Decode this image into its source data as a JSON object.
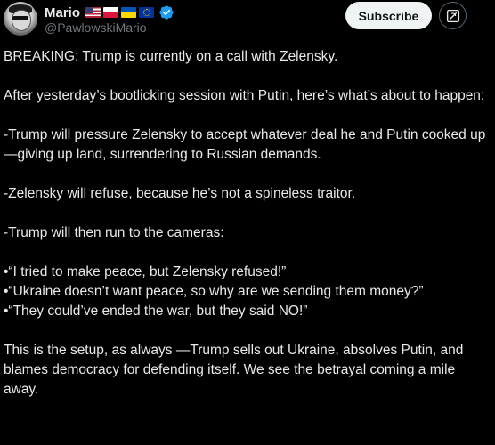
{
  "author": {
    "display_name": "Mario",
    "handle": "@PawlowskiMario",
    "flags": [
      "us-flag-icon",
      "poland-flag-icon",
      "ukraine-flag-icon",
      "eu-flag-icon"
    ],
    "verified_icon": "verified-badge-icon",
    "verified_color": "#1d9bf0"
  },
  "actions": {
    "subscribe_label": "Subscribe",
    "grok_icon": "grok-icon"
  },
  "tweet": {
    "p1": "BREAKING: Trump is currently on a call with Zelensky.",
    "p2": "After yesterday’s bootlicking session with Putin, here’s what’s about to happen:",
    "p3": "-Trump will pressure Zelensky to accept whatever deal he and Putin cooked up—giving up land, surrendering to Russian demands.",
    "p4": "-Zelensky will refuse, because he’s not a spineless traitor.",
    "p5": "-Trump will then run to the cameras:",
    "bullets": [
      "•“I tried to make peace, but Zelensky refused!”",
      "•“Ukraine doesn’t want peace, so why are we sending them money?”",
      "•“They could’ve ended the war, but they said NO!”"
    ],
    "p6": "This is the setup, as always —Trump sells out Ukraine, absolves Putin, and blames democracy for defending itself. We see the betrayal coming a mile away."
  },
  "colors": {
    "background": "#000000",
    "text": "#e7e9ea",
    "secondary_text": "#71767b",
    "button_bg": "#eff3f4"
  }
}
